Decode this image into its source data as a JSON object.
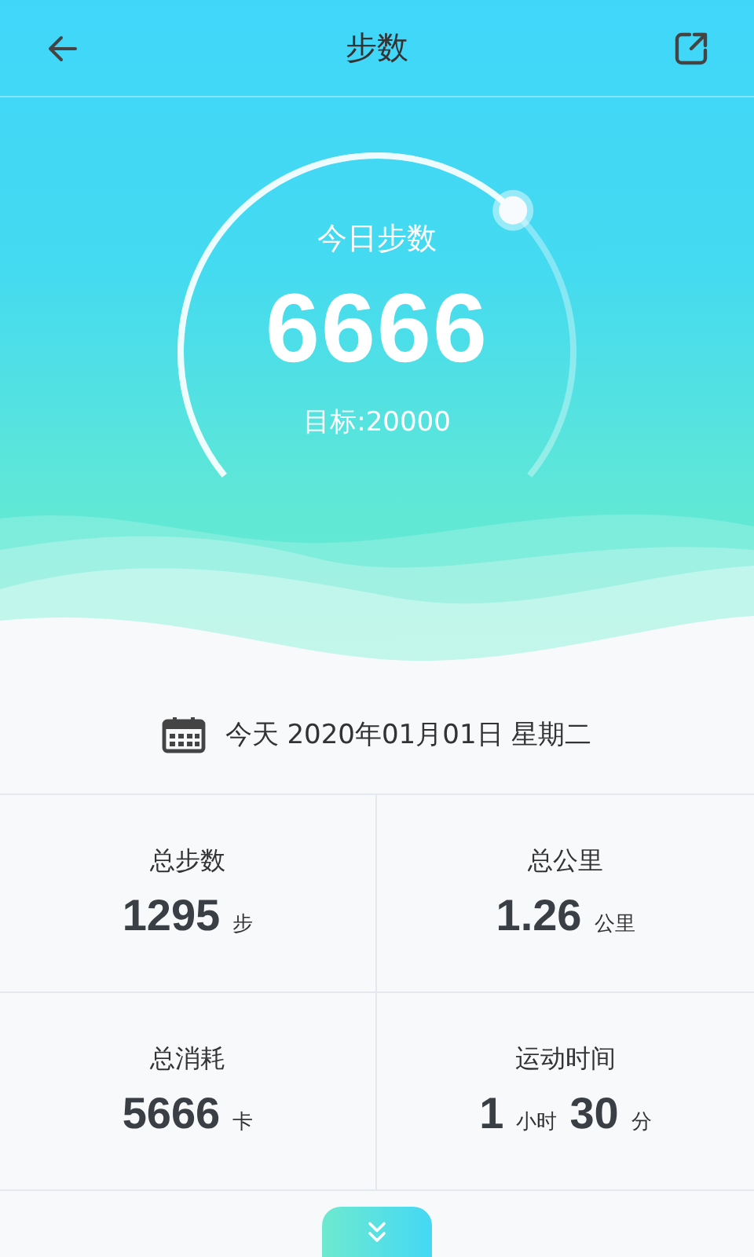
{
  "header": {
    "title": "步数"
  },
  "today": {
    "label": "今日步数",
    "steps": "6666",
    "goal": "目标:20000"
  },
  "date": "今天 2020年01月01日 星期二",
  "stats": [
    {
      "label": "总步数",
      "parts": [
        {
          "text": "1295",
          "kind": "value"
        },
        {
          "text": "步",
          "kind": "unit"
        }
      ]
    },
    {
      "label": "总公里",
      "parts": [
        {
          "text": "1.26",
          "kind": "value"
        },
        {
          "text": "公里",
          "kind": "unit"
        }
      ]
    },
    {
      "label": "总消耗",
      "parts": [
        {
          "text": "5666",
          "kind": "value"
        },
        {
          "text": "卡",
          "kind": "unit"
        }
      ]
    },
    {
      "label": "运动时间",
      "parts": [
        {
          "text": "1",
          "kind": "value"
        },
        {
          "text": "小时",
          "kind": "unit"
        },
        {
          "text": "30",
          "kind": "value"
        },
        {
          "text": "分",
          "kind": "unit"
        }
      ]
    }
  ]
}
